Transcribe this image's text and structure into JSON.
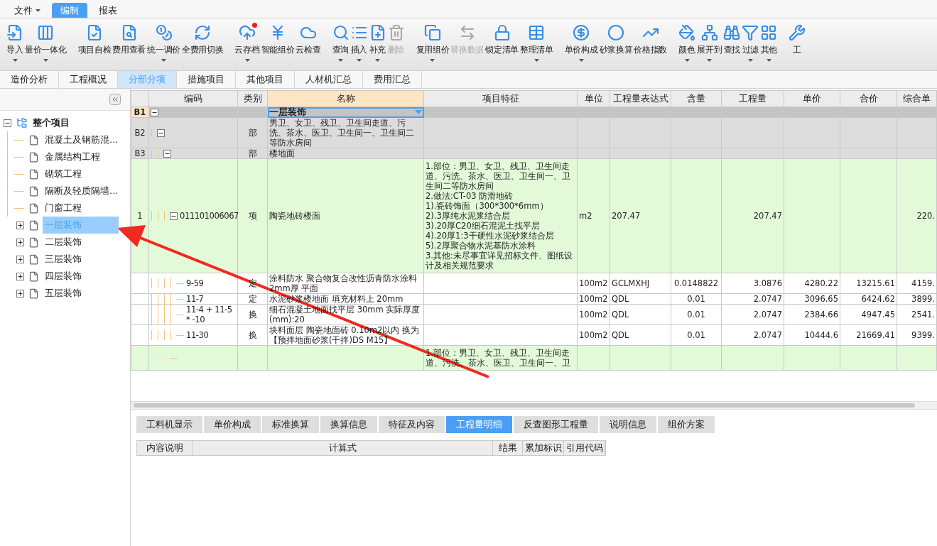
{
  "menu": [
    {
      "label": "文件",
      "dropdown": true,
      "selected": false
    },
    {
      "label": "编制",
      "dropdown": false,
      "selected": true
    },
    {
      "label": "报表",
      "dropdown": false,
      "selected": false
    }
  ],
  "toolbar": {
    "groups": [
      [
        {
          "label": "导入",
          "dropdown": true,
          "disabled": false,
          "badge": false
        },
        {
          "label": "量价一体化",
          "dropdown": true,
          "disabled": false,
          "badge": false
        }
      ],
      [
        {
          "label": "项目自检",
          "dropdown": false,
          "disabled": false,
          "badge": false
        },
        {
          "label": "费用查看",
          "dropdown": false,
          "disabled": false,
          "badge": false
        },
        {
          "label": "统一调价",
          "dropdown": true,
          "disabled": false,
          "badge": false
        },
        {
          "label": "全费用切换",
          "dropdown": false,
          "disabled": false,
          "badge": false
        }
      ],
      [
        {
          "label": "云存档",
          "dropdown": true,
          "disabled": false,
          "badge": true
        },
        {
          "label": "智能组价",
          "dropdown": false,
          "disabled": false,
          "badge": false
        },
        {
          "label": "云检查",
          "dropdown": false,
          "disabled": false,
          "badge": false
        }
      ],
      [
        {
          "label": "查询",
          "dropdown": true,
          "disabled": false,
          "badge": false
        },
        {
          "label": "插入",
          "dropdown": true,
          "disabled": false,
          "badge": false
        },
        {
          "label": "补充",
          "dropdown": true,
          "disabled": false,
          "badge": false
        },
        {
          "label": "删除",
          "dropdown": false,
          "disabled": true,
          "badge": false
        }
      ],
      [
        {
          "label": "复用组价",
          "dropdown": true,
          "disabled": false,
          "badge": false
        },
        {
          "label": "替换数据",
          "dropdown": false,
          "disabled": true,
          "badge": false
        },
        {
          "label": "锁定清单",
          "dropdown": false,
          "disabled": false,
          "badge": false
        },
        {
          "label": "整理清单",
          "dropdown": true,
          "disabled": false,
          "badge": false
        }
      ],
      [
        {
          "label": "单价构成",
          "dropdown": true,
          "disabled": false,
          "badge": false
        },
        {
          "label": "砂浆换算",
          "dropdown": false,
          "disabled": false,
          "badge": false
        },
        {
          "label": "价格指数",
          "dropdown": false,
          "disabled": false,
          "badge": false
        }
      ],
      [
        {
          "label": "颜色",
          "dropdown": true,
          "disabled": false,
          "badge": false
        },
        {
          "label": "展开到",
          "dropdown": true,
          "disabled": false,
          "badge": false
        },
        {
          "label": "查找",
          "dropdown": false,
          "disabled": false,
          "badge": false
        },
        {
          "label": "过滤",
          "dropdown": true,
          "disabled": false,
          "badge": false
        },
        {
          "label": "其他",
          "dropdown": true,
          "disabled": false,
          "badge": false
        }
      ],
      [
        {
          "label": "工",
          "dropdown": false,
          "disabled": false,
          "badge": false
        }
      ]
    ]
  },
  "page_tabs": [
    {
      "label": "造价分析",
      "selected": false
    },
    {
      "label": "工程概况",
      "selected": false
    },
    {
      "label": "分部分项",
      "selected": true
    },
    {
      "label": "措施项目",
      "selected": false
    },
    {
      "label": "其他项目",
      "selected": false
    },
    {
      "label": "人材机汇总",
      "selected": false
    },
    {
      "label": "费用汇总",
      "selected": false
    }
  ],
  "tree": {
    "label": "整个项目",
    "expanded": true,
    "children": [
      {
        "label": "混凝土及钢筋混...",
        "kind": "leaf",
        "selected": false
      },
      {
        "label": "金属结构工程",
        "kind": "leaf",
        "selected": false
      },
      {
        "label": "砌筑工程",
        "kind": "leaf",
        "selected": false
      },
      {
        "label": "隔断及轻质隔墙...",
        "kind": "leaf",
        "selected": false
      },
      {
        "label": "门窗工程",
        "kind": "leaf",
        "selected": false
      },
      {
        "label": "一层装饰",
        "kind": "folder",
        "expanded": false,
        "selected": true
      },
      {
        "label": "二层装饰",
        "kind": "folder",
        "expanded": false,
        "selected": false
      },
      {
        "label": "三层装饰",
        "kind": "folder",
        "expanded": false,
        "selected": false
      },
      {
        "label": "四层装饰",
        "kind": "folder",
        "expanded": false,
        "selected": false
      },
      {
        "label": "五层装饰",
        "kind": "folder",
        "expanded": false,
        "selected": false
      }
    ]
  },
  "table": {
    "columns": [
      {
        "label": "编码",
        "selected": false
      },
      {
        "label": "类别",
        "selected": false
      },
      {
        "label": "名称",
        "selected": true
      },
      {
        "label": "项目特征",
        "selected": false
      },
      {
        "label": "单位",
        "selected": false
      },
      {
        "label": "工程量表达式",
        "selected": false
      },
      {
        "label": "含量",
        "selected": false
      },
      {
        "label": "工程量",
        "selected": false
      },
      {
        "label": "单价",
        "selected": false
      },
      {
        "label": "合价",
        "selected": false
      },
      {
        "label": "综合单",
        "selected": false
      }
    ],
    "rows": [
      {
        "kind": "section",
        "num": "B1",
        "selected": true,
        "expanded": true,
        "name": "一层装饰",
        "children": [
          {
            "kind": "section",
            "num": "B2",
            "selected": false,
            "expanded": true,
            "type": "部",
            "name": "男卫、女卫、残卫、卫生间走道、污洗、茶水、医卫、卫生间一、卫生间二等防水房间",
            "children": [
              {
                "kind": "section",
                "num": "B3",
                "selected": false,
                "expanded": true,
                "type": "部",
                "name": "楼地面",
                "children": [
                  {
                    "kind": "item",
                    "num": "1",
                    "selected": false,
                    "expanded": true,
                    "code": "011101006067",
                    "type": "项",
                    "name": "陶瓷地砖楼面",
                    "feature": "1.部位：男卫、女卫、残卫、卫生间走道、污洗、茶水、医卫、卫生间一、卫生间二等防水房间\n2.做法:CT-03 防滑地砖\n1).瓷砖饰面（300*300*6mm）\n2).3厚纯水泥浆结合层\n3).20厚C20细石混泥土找平层\n4).20厚1:3干硬性水泥砂浆结合层\n5).2厚聚合物水泥基防水涂料\n3.其他:未尽事宜详见招标文件、图纸设计及相关规范要求",
                    "unit": "m2",
                    "expr": "207.47",
                    "qty": "207.47",
                    "comp": "220.",
                    "children": [
                      {
                        "kind": "quota",
                        "code": "9-59",
                        "type": "定",
                        "name": "涂料防水 聚合物复合改性沥青防水涂料 2mm厚 平面",
                        "unit": "100m2",
                        "expr": "GCLMXHJ",
                        "content": "0.0148822",
                        "qty": "3.0876",
                        "price": "4280.22",
                        "total": "13215.61",
                        "comp": "4159."
                      },
                      {
                        "kind": "quota",
                        "code": "11-7",
                        "type": "定",
                        "name": "水泥砂浆楼地面 填充材料上 20mm",
                        "unit": "100m2",
                        "expr": "QDL",
                        "content": "0.01",
                        "qty": "2.0747",
                        "price": "3096.65",
                        "total": "6424.62",
                        "comp": "3899."
                      },
                      {
                        "kind": "quota",
                        "code": "11-4 + 11-5 * -10",
                        "type": "换",
                        "name": "细石混凝土地面找平层 30mm  实际厚度(mm):20",
                        "unit": "100m2",
                        "expr": "QDL",
                        "content": "0.01",
                        "qty": "2.0747",
                        "price": "2384.66",
                        "total": "4947.45",
                        "comp": "2541."
                      },
                      {
                        "kind": "quota",
                        "code": "11-30",
                        "type": "换",
                        "name": "块料面层 陶瓷地面砖 0.10m2以内  换为【预拌地面砂浆(干拌)DS M15】",
                        "unit": "100m2",
                        "expr": "QDL",
                        "content": "0.01",
                        "qty": "2.0747",
                        "price": "10444.6",
                        "total": "21669.41",
                        "comp": "9399."
                      }
                    ]
                  },
                  {
                    "kind": "item",
                    "selected": false,
                    "feature": "1.部位：男卫、女卫、残卫、卫生间走道、污洗、茶水、医卫、卫生间一、卫"
                  }
                ]
              }
            ]
          }
        ]
      }
    ]
  },
  "bottom_tabs": [
    {
      "label": "工料机显示",
      "selected": false
    },
    {
      "label": "单价构成",
      "selected": false
    },
    {
      "label": "标准换算",
      "selected": false
    },
    {
      "label": "换算信息",
      "selected": false
    },
    {
      "label": "特征及内容",
      "selected": false
    },
    {
      "label": "工程量明细",
      "selected": true
    },
    {
      "label": "反查图形工程量",
      "selected": false
    },
    {
      "label": "说明信息",
      "selected": false
    },
    {
      "label": "组价方案",
      "selected": false
    }
  ],
  "detail_table": {
    "columns": [
      "内容说明",
      "计算式",
      "结果",
      "累加标识",
      "引用代码"
    ]
  }
}
